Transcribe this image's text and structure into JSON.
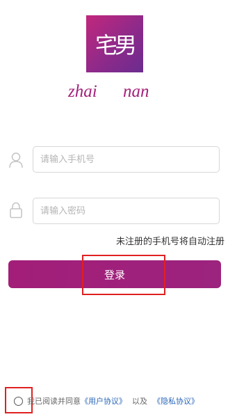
{
  "app": {
    "logo_text": "宅男",
    "wordmark": [
      "zhai",
      "nan"
    ]
  },
  "form": {
    "phone_placeholder": "请输入手机号",
    "password_placeholder": "请输入密码",
    "auto_register_hint": "未注册的手机号将自动注册",
    "login_label": "登录"
  },
  "agreement": {
    "prefix": "我已阅读并同意",
    "user_agreement": "《用户协议》",
    "joiner": "以及",
    "privacy_policy": "《隐私协议》"
  },
  "colors": {
    "brand": "#a21e78",
    "link": "#2a66b8",
    "highlight": "#e02020"
  },
  "icons": {
    "phone_field": "user-icon",
    "password_field": "lock-icon"
  }
}
